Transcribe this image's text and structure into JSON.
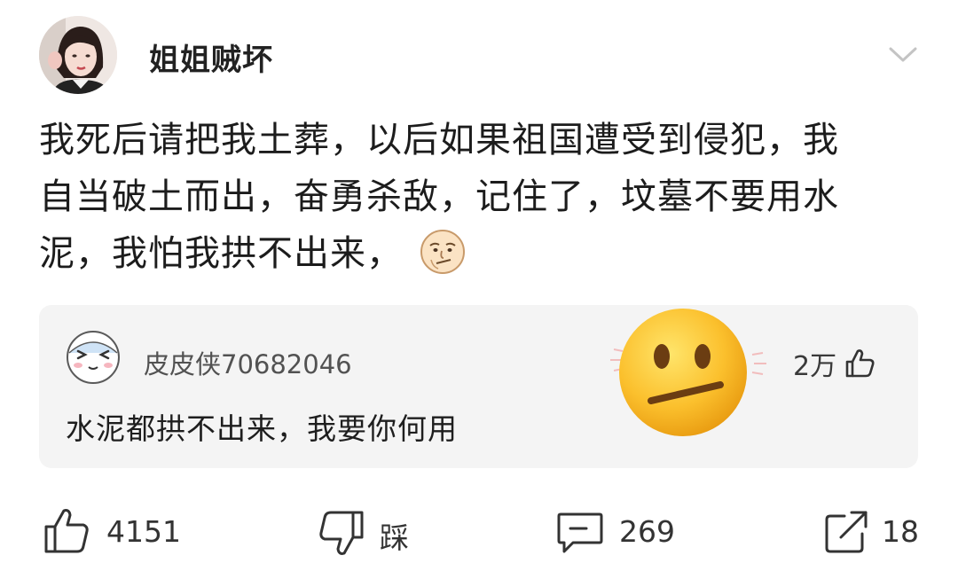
{
  "post": {
    "author": "姐姐贼坏",
    "text_line1": "我死后请把我土葬，以后如果祖国遭受到侵犯，我",
    "text_line2": "自当破土而出，奋勇杀敌，记住了，坟墓不要用水",
    "text_line3": "泥，我怕我拱不出来，",
    "inline_emoji": "smirk-face-emoji"
  },
  "top_comment": {
    "username": "皮皮侠70682046",
    "text": "水泥都拱不出来，我要你何用",
    "like_count": "2万",
    "reaction_emoji": "neutral-face-emoji"
  },
  "actions": {
    "like_count": "4151",
    "dislike_label": "踩",
    "comment_count": "269",
    "share_count": "18"
  },
  "colors": {
    "background": "#ffffff",
    "comment_background": "#f4f4f4",
    "text": "#1c1c1c",
    "secondary_text": "#525252",
    "icon": "#333333"
  }
}
